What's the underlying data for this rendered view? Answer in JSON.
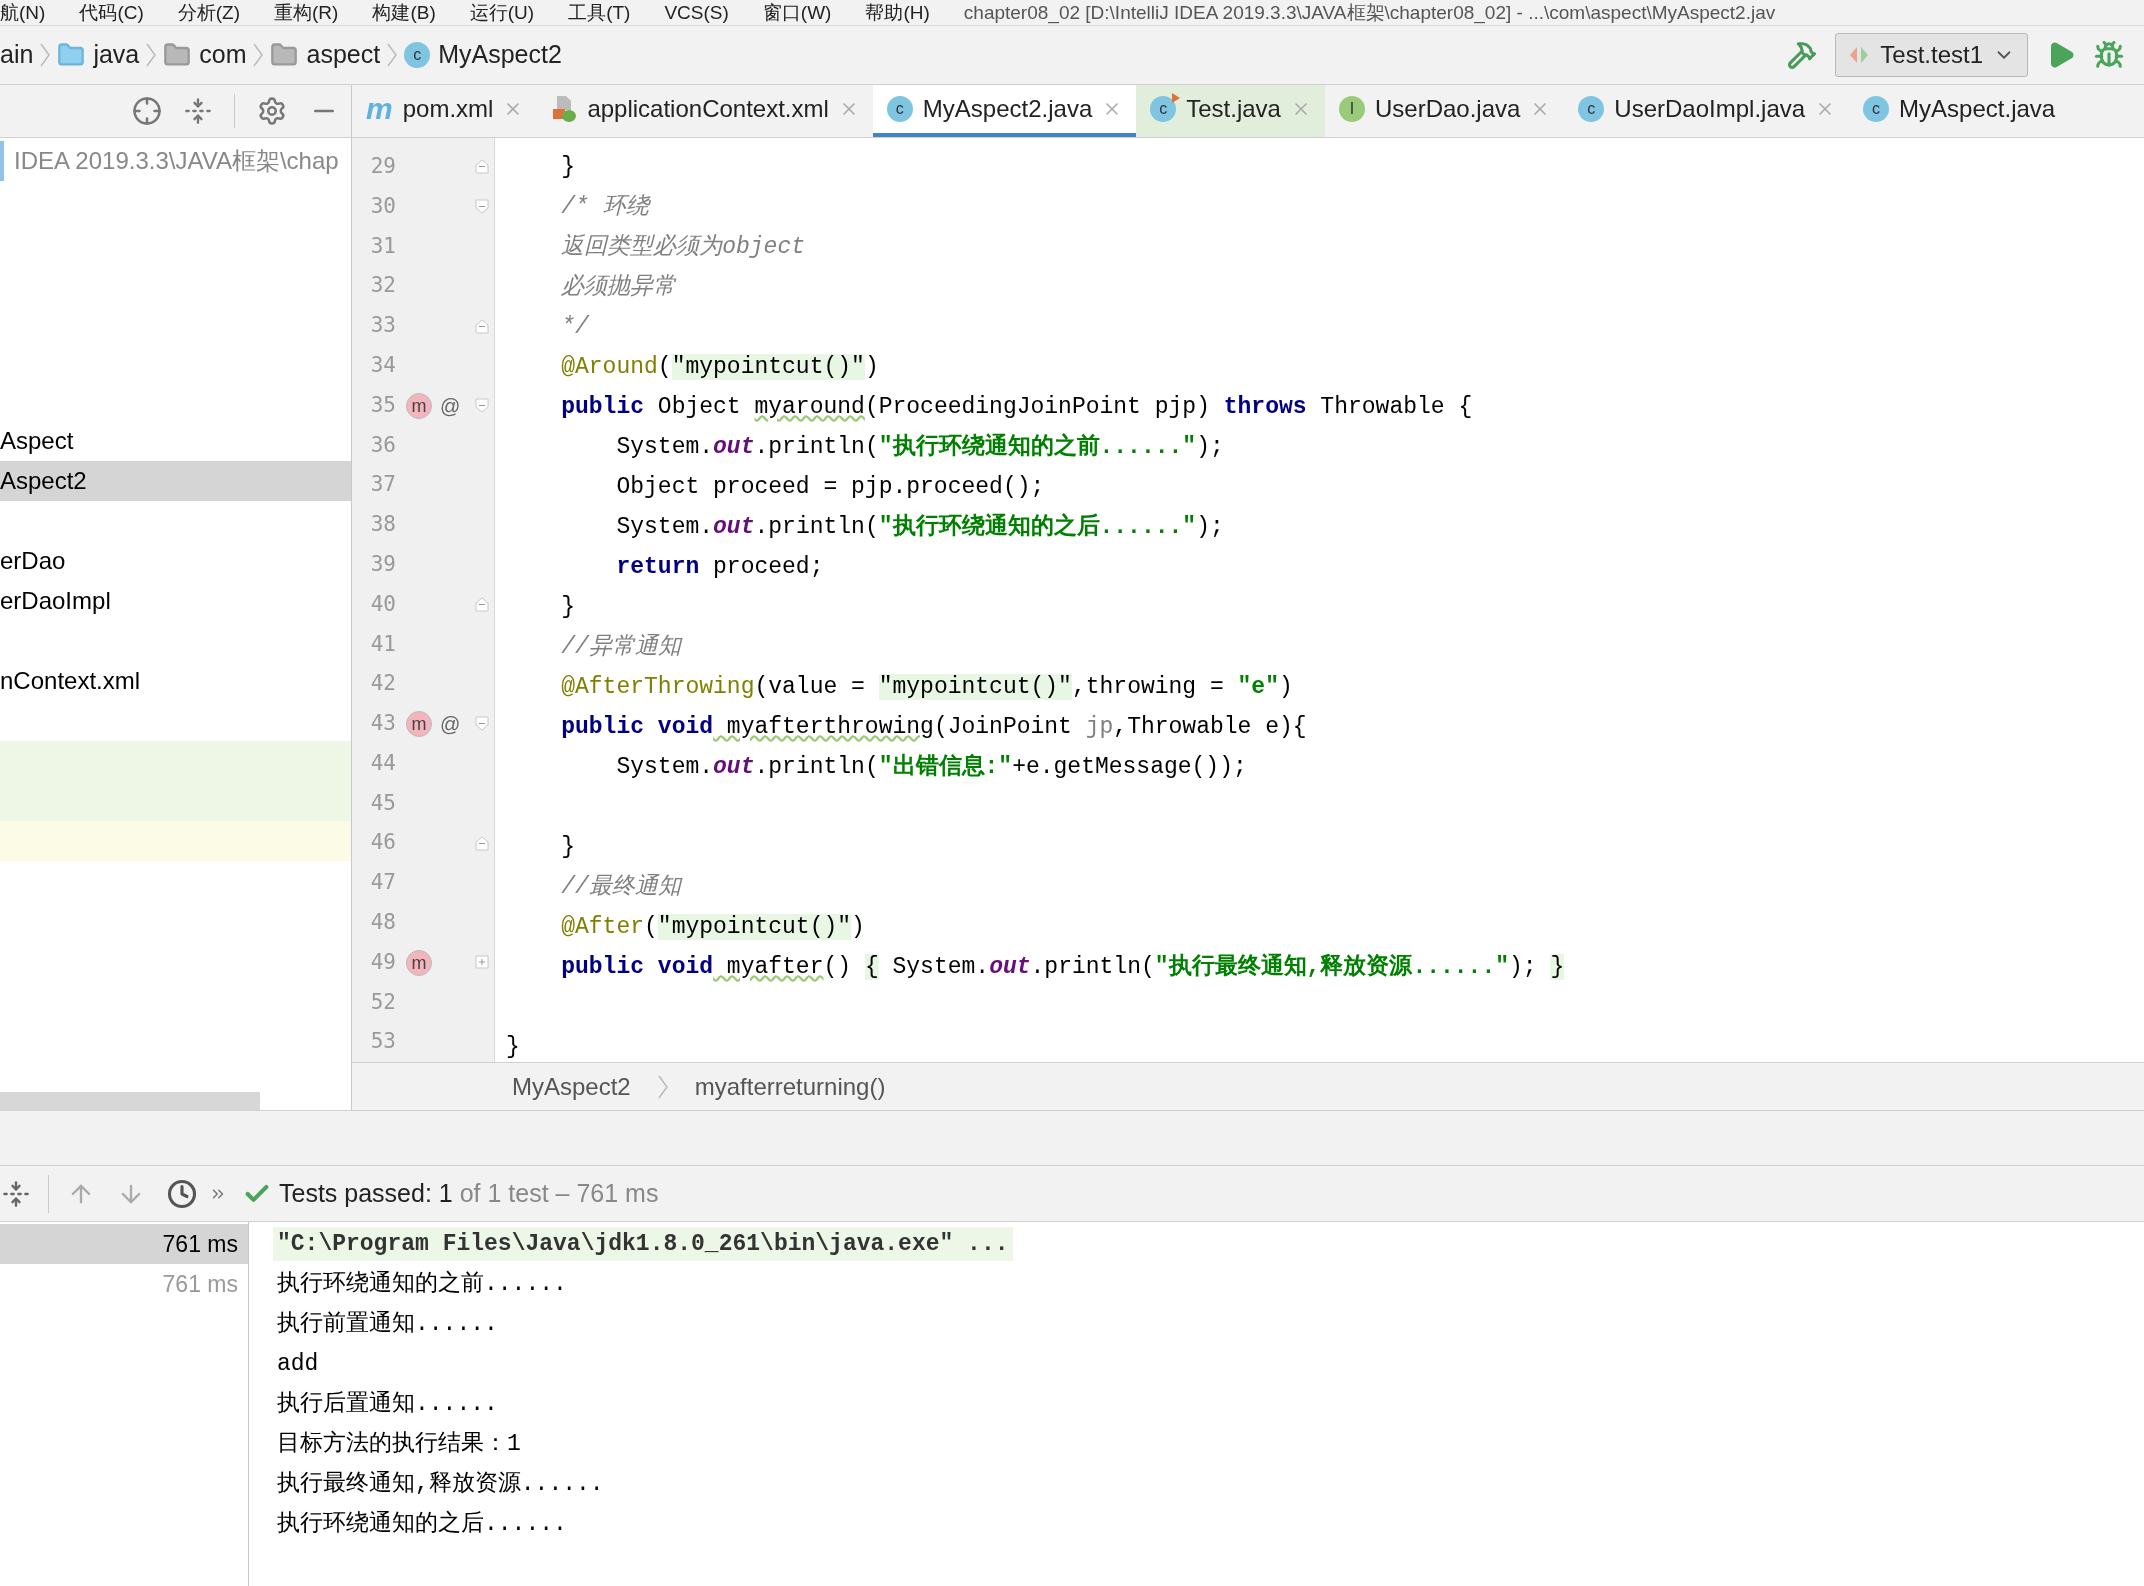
{
  "menu_bar": {
    "items": [
      "航(N)",
      "代码(C)",
      "分析(Z)",
      "重构(R)",
      "构建(B)",
      "运行(U)",
      "工具(T)",
      "VCS(S)",
      "窗口(W)",
      "帮助(H)"
    ],
    "title": "chapter08_02 [D:\\IntelliJ IDEA 2019.3.3\\JAVA框架\\chapter08_02] - ...\\com\\aspect\\MyAspect2.jav"
  },
  "navigation_bar": {
    "crumbs": [
      {
        "label": "ain",
        "kind": "none"
      },
      {
        "label": "java",
        "kind": "source-folder"
      },
      {
        "label": "com",
        "kind": "package"
      },
      {
        "label": "aspect",
        "kind": "package"
      },
      {
        "label": "MyAspect2",
        "kind": "class",
        "icon_letter": "c"
      }
    ],
    "run_config": "Test.test1"
  },
  "project_panel": {
    "rows": [
      {
        "label": "IDEA 2019.3.3\\JAVA框架\\chap",
        "selected": false,
        "kind": "path"
      },
      {
        "label": "Aspect",
        "selected": false,
        "kind": "item"
      },
      {
        "label": "Aspect2",
        "selected": true,
        "kind": "item"
      },
      {
        "label": "erDao",
        "selected": false,
        "kind": "item"
      },
      {
        "label": "erDaoImpl",
        "selected": false,
        "kind": "item"
      },
      {
        "label": "nContext.xml",
        "selected": false,
        "kind": "item"
      }
    ]
  },
  "tabs": [
    {
      "label": "pom.xml",
      "kind": "maven",
      "icon_letter": "m",
      "selected": false,
      "closable": true
    },
    {
      "label": "applicationContext.xml",
      "kind": "spring-xml",
      "selected": false,
      "closable": true
    },
    {
      "label": "MyAspect2.java",
      "kind": "class",
      "icon_letter": "c",
      "selected": true,
      "closable": true
    },
    {
      "label": "Test.java",
      "kind": "test-class",
      "icon_letter": "c",
      "selected": false,
      "closable": true
    },
    {
      "label": "UserDao.java",
      "kind": "interface",
      "icon_letter": "I",
      "selected": false,
      "closable": true
    },
    {
      "label": "UserDaoImpl.java",
      "kind": "class",
      "icon_letter": "c",
      "selected": false,
      "closable": true
    },
    {
      "label": "MyAspect.java",
      "kind": "class",
      "icon_letter": "c",
      "selected": false,
      "closable": false
    }
  ],
  "editor": {
    "lines": [
      {
        "number": "29",
        "gutter": [
          {
            "kind": "fold-end"
          }
        ],
        "tokens": [
          {
            "text": "    }",
            "kind": "plain"
          }
        ]
      },
      {
        "number": "30",
        "gutter": [
          {
            "kind": "fold-start"
          }
        ],
        "tokens": [
          {
            "text": "    /* 环绕",
            "kind": "comment"
          }
        ]
      },
      {
        "number": "31",
        "tokens": [
          {
            "text": "    返回类型必须为object",
            "kind": "comment"
          }
        ]
      },
      {
        "number": "32",
        "tokens": [
          {
            "text": "    必须抛异常",
            "kind": "comment"
          }
        ]
      },
      {
        "number": "33",
        "gutter": [
          {
            "kind": "fold-end"
          }
        ],
        "tokens": [
          {
            "text": "    */",
            "kind": "comment"
          }
        ]
      },
      {
        "number": "34",
        "tokens": [
          {
            "text": "    @Around",
            "kind": "annotation"
          },
          {
            "text": "(",
            "kind": "plain"
          },
          {
            "text": "\"mypointcut()\"",
            "kind": "highlight"
          },
          {
            "text": ")",
            "kind": "plain"
          }
        ]
      },
      {
        "number": "35",
        "gutter": [
          {
            "kind": "override",
            "text": "m"
          },
          {
            "kind": "annotation",
            "text": "@"
          },
          {
            "kind": "fold-start"
          }
        ],
        "tokens": [
          {
            "text": "    public",
            "kind": "keyword"
          },
          {
            "text": " Object ",
            "kind": "plain"
          },
          {
            "text": "myaround",
            "kind": "unused"
          },
          {
            "text": "(ProceedingJoinPoint pjp) ",
            "kind": "plain"
          },
          {
            "text": "throws",
            "kind": "keyword"
          },
          {
            "text": " Throwable {",
            "kind": "plain"
          }
        ]
      },
      {
        "number": "36",
        "tokens": [
          {
            "text": "        System.",
            "kind": "plain"
          },
          {
            "text": "out",
            "kind": "field"
          },
          {
            "text": ".println(",
            "kind": "plain"
          },
          {
            "text": "\"执行环绕通知的之前......\"",
            "kind": "string"
          },
          {
            "text": ");",
            "kind": "plain"
          }
        ]
      },
      {
        "number": "37",
        "tokens": [
          {
            "text": "        Object proceed = pjp.proceed();",
            "kind": "plain"
          }
        ]
      },
      {
        "number": "38",
        "tokens": [
          {
            "text": "        System.",
            "kind": "plain"
          },
          {
            "text": "out",
            "kind": "field"
          },
          {
            "text": ".println(",
            "kind": "plain"
          },
          {
            "text": "\"执行环绕通知的之后......\"",
            "kind": "string"
          },
          {
            "text": ");",
            "kind": "plain"
          }
        ]
      },
      {
        "number": "39",
        "tokens": [
          {
            "text": "        return",
            "kind": "keyword"
          },
          {
            "text": " proceed;",
            "kind": "plain"
          }
        ]
      },
      {
        "number": "40",
        "gutter": [
          {
            "kind": "fold-end"
          }
        ],
        "tokens": [
          {
            "text": "    }",
            "kind": "plain"
          }
        ]
      },
      {
        "number": "41",
        "tokens": [
          {
            "text": "    //异常通知",
            "kind": "comment"
          }
        ]
      },
      {
        "number": "42",
        "tokens": [
          {
            "text": "    @AfterThrowing",
            "kind": "annotation"
          },
          {
            "text": "(value = ",
            "kind": "plain"
          },
          {
            "text": "\"mypointcut()\"",
            "kind": "highlight"
          },
          {
            "text": ",throwing = ",
            "kind": "plain"
          },
          {
            "text": "\"e\"",
            "kind": "string"
          },
          {
            "text": ")",
            "kind": "plain"
          }
        ]
      },
      {
        "number": "43",
        "gutter": [
          {
            "kind": "override",
            "text": "m"
          },
          {
            "kind": "annotation",
            "text": "@"
          },
          {
            "kind": "fold-start"
          }
        ],
        "tokens": [
          {
            "text": "    public void",
            "kind": "keyword"
          },
          {
            "text": " myafterthrowing",
            "kind": "unused"
          },
          {
            "text": "(JoinPoint ",
            "kind": "plain"
          },
          {
            "text": "jp",
            "kind": "param"
          },
          {
            "text": ",Throwable e){",
            "kind": "plain"
          }
        ]
      },
      {
        "number": "44",
        "tokens": [
          {
            "text": "        System.",
            "kind": "plain"
          },
          {
            "text": "out",
            "kind": "field"
          },
          {
            "text": ".println(",
            "kind": "plain"
          },
          {
            "text": "\"出错信息:\"",
            "kind": "string"
          },
          {
            "text": "+e.getMessage());",
            "kind": "plain"
          }
        ]
      },
      {
        "number": "45"
      },
      {
        "number": "46",
        "gutter": [
          {
            "kind": "fold-end"
          }
        ],
        "tokens": [
          {
            "text": "    }",
            "kind": "plain"
          }
        ]
      },
      {
        "number": "47",
        "tokens": [
          {
            "text": "    //最终通知",
            "kind": "comment"
          }
        ]
      },
      {
        "number": "48",
        "tokens": [
          {
            "text": "    @After",
            "kind": "annotation"
          },
          {
            "text": "(",
            "kind": "plain"
          },
          {
            "text": "\"mypointcut()\"",
            "kind": "highlight"
          },
          {
            "text": ")",
            "kind": "plain"
          }
        ]
      },
      {
        "number": "49",
        "gutter": [
          {
            "kind": "override",
            "text": "m"
          },
          {
            "kind": "fold-collapsed"
          }
        ],
        "tokens": [
          {
            "text": "    public void",
            "kind": "keyword"
          },
          {
            "text": " myafter",
            "kind": "unused"
          },
          {
            "text": "() ",
            "kind": "plain"
          },
          {
            "text": "{",
            "kind": "highlight"
          },
          {
            "text": " System.",
            "kind": "plain"
          },
          {
            "text": "out",
            "kind": "field"
          },
          {
            "text": ".println(",
            "kind": "plain"
          },
          {
            "text": "\"执行最终通知,释放资源......\"",
            "kind": "string"
          },
          {
            "text": "); ",
            "kind": "plain"
          },
          {
            "text": "}",
            "kind": "highlight"
          }
        ]
      },
      {
        "number": "52"
      },
      {
        "number": "53",
        "tokens": [
          {
            "text": "}",
            "kind": "plain"
          }
        ]
      }
    ],
    "breadcrumbs": [
      "MyAspect2",
      "myafterreturning()"
    ]
  },
  "run_panel": {
    "status": "Tests passed: 1",
    "status_detail": "of 1 test – 761 ms",
    "tests": [
      {
        "time": "761 ms",
        "selected": true
      },
      {
        "time": "761 ms",
        "selected": false
      }
    ],
    "console": [
      {
        "text": "\"C:\\Program Files\\Java\\jdk1.8.0_261\\bin\\java.exe\" ...",
        "kind": "command"
      },
      {
        "text": "执行环绕通知的之前......",
        "kind": "output"
      },
      {
        "text": "执行前置通知......",
        "kind": "output"
      },
      {
        "text": "add",
        "kind": "output"
      },
      {
        "text": "执行后置通知......",
        "kind": "output"
      },
      {
        "text": "目标方法的执行结果：1",
        "kind": "output"
      },
      {
        "text": "执行最终通知,释放资源......",
        "kind": "output"
      },
      {
        "text": "执行环绕通知的之后......",
        "kind": "output"
      }
    ]
  }
}
